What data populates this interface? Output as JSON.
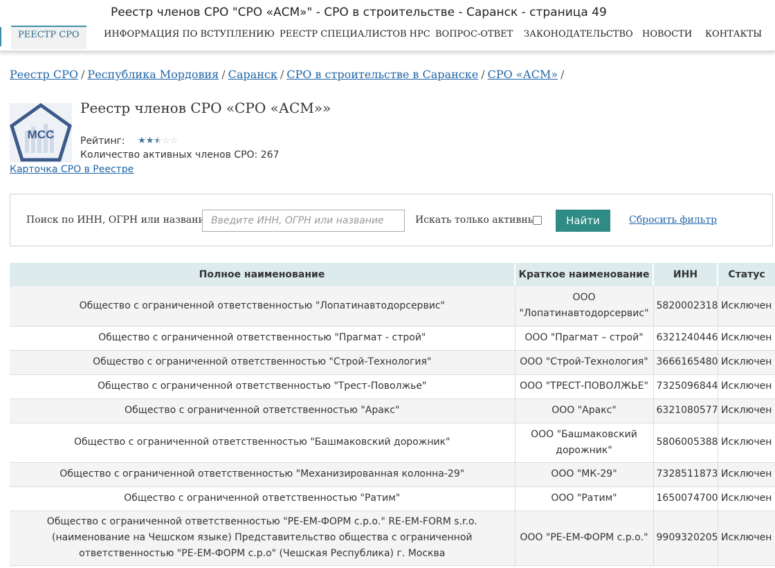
{
  "window": {
    "title": "Реестр членов СРО \"СРО «АСМ»\" - СРО в строительстве - Саранск - страница 49"
  },
  "nav": {
    "items": [
      {
        "label": "Реестр СРО",
        "active": true
      },
      {
        "label": "Информация по вступлению"
      },
      {
        "label": "Реестр специалистов НРС"
      },
      {
        "label": "Вопрос-ответ"
      },
      {
        "label": "Законодательство"
      },
      {
        "label": "Новости"
      },
      {
        "label": "Контакты"
      }
    ]
  },
  "breadcrumbs": [
    "Реестр СРО",
    "Республика Мордовия",
    "Саранск",
    "СРО в строительстве в Саранске",
    "СРО «АСМ»"
  ],
  "breadcrumb_sep": "/",
  "org": {
    "logo_text": "МСС",
    "title": "Реестр членов СРО «СРО «АСМ»»",
    "rating_label": "Рейтинг:",
    "rating_value": 2.5,
    "rating_max": 5,
    "members_label": "Количество активных членов СРО: 267",
    "card_link": "Карточка СРО в Реестре"
  },
  "search": {
    "label": "Поиск по ИНН, ОГРН или названию:",
    "placeholder": "Введите ИНН, ОГРН или название",
    "value": "",
    "active_label": "Искать только активные",
    "active_checked": false,
    "button": "Найти",
    "reset": "Сбросить фильтр"
  },
  "table": {
    "headers": [
      "Полное наименование",
      "Краткое наименование",
      "ИНН",
      "Статус"
    ],
    "rows": [
      {
        "full": "Общество с ограниченной ответственностью \"Лопатинавтодорсервис\"",
        "short": "ООО \"Лопатинавтодорсервис\"",
        "inn": "5820002318",
        "status": "Исключен"
      },
      {
        "full": "Общество с ограниченной ответственностью \"Прагмат - строй\"",
        "short": "ООО \"Прагмат – строй\"",
        "inn": "6321240446",
        "status": "Исключен"
      },
      {
        "full": "Общество с ограниченной ответственностью \"Строй-Технология\"",
        "short": "ООО \"Строй-Технология\"",
        "inn": "3666165480",
        "status": "Исключен"
      },
      {
        "full": "Общество с ограниченной ответственностью \"Трест-Поволжье\"",
        "short": "ООО \"ТРЕСТ-ПОВОЛЖЬЕ\"",
        "inn": "7325096844",
        "status": "Исключен"
      },
      {
        "full": "Общество с ограниченной ответственностью \"Аракс\"",
        "short": "ООО \"Аракс\"",
        "inn": "6321080577",
        "status": "Исключен"
      },
      {
        "full": "Общество с ограниченной ответственностью \"Башмаковский дорожник\"",
        "short": "ООО \"Башмаковский дорожник\"",
        "inn": "5806005388",
        "status": "Исключен"
      },
      {
        "full": "Общество с ограниченной ответственностью \"Механизированная колонна-29\"",
        "short": "ООО \"МК-29\"",
        "inn": "7328511873",
        "status": "Исключен"
      },
      {
        "full": "Общество с ограниченной ответственностью \"Ратим\"",
        "short": "ООО \"Ратим\"",
        "inn": "1650074700",
        "status": "Исключен"
      },
      {
        "full": "Общество с ограниченной ответственностью \"РЕ-ЕМ-ФОРМ с.р.о.\" RE-EM-FORM s.r.o. (наименование на Чешском языке) Представительство общества с ограниченной ответственностью \"РЕ-ЕМ-ФОРМ с.р.о\" (Чешская Республика) г. Москва",
        "short": "ООО \"РЕ-ЕМ-ФОРМ с.р.о.\"",
        "inn": "9909320205",
        "status": "Исключен"
      }
    ]
  },
  "colors": {
    "accent": "#3a8ea8",
    "button": "#2e8b86",
    "link": "#1f65a8",
    "header_bg": "#ddebed"
  }
}
